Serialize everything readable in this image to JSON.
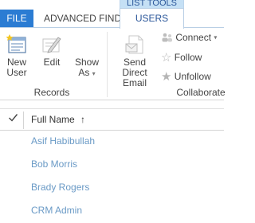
{
  "tabs": {
    "file": "FILE",
    "advanced_find": "ADVANCED FIND",
    "contextual_header": "LIST TOOLS",
    "users": "USERS"
  },
  "ribbon": {
    "records": {
      "label": "Records",
      "new_user": [
        "New",
        "User"
      ],
      "edit": "Edit",
      "show_as": [
        "Show",
        "As"
      ]
    },
    "collaborate": {
      "label": "Collaborate",
      "send_direct_email": [
        "Send Direct",
        "Email"
      ],
      "connect": "Connect",
      "follow": "Follow",
      "unfollow": "Unfollow"
    }
  },
  "grid": {
    "column": "Full Name",
    "sort_glyph": "↑",
    "rows": [
      "Asif Habibullah",
      "Bob Morris",
      "Brady Rogers",
      "CRM Admin"
    ]
  },
  "colors": {
    "file_tab": "#2b7cd3",
    "contextual": "#c5e0f5",
    "link": "#6a9ac6"
  },
  "icons": [
    "new-user-icon",
    "edit-icon",
    "show-as-icon",
    "send-direct-email-icon",
    "connect-icon",
    "follow-icon",
    "unfollow-icon",
    "checkmark-icon",
    "sort-ascending-icon"
  ]
}
